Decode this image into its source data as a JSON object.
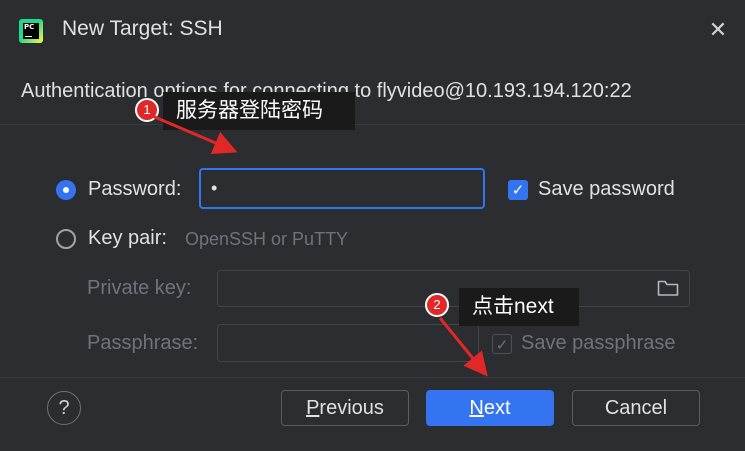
{
  "window": {
    "title": "New Target: SSH",
    "close_glyph": "✕",
    "app_icon_text": "PC"
  },
  "header": {
    "text": "Authentication options for connecting to flyvideo@10.193.194.120:22"
  },
  "auth": {
    "password_label": "Password:",
    "password_value": "•",
    "save_password_label": "Save password",
    "save_password_checked": true,
    "keypair_label": "Key pair:",
    "keypair_hint": "OpenSSH or PuTTY",
    "private_key_label": "Private key:",
    "private_key_value": "",
    "passphrase_label": "Passphrase:",
    "passphrase_value": "",
    "save_passphrase_label": "Save passphrase",
    "save_passphrase_checked": true,
    "selected": "password"
  },
  "footer": {
    "help_glyph": "?",
    "previous_first": "P",
    "previous_rest": "revious",
    "next_first": "N",
    "next_rest": "ext",
    "cancel_label": "Cancel"
  },
  "annotations": [
    {
      "number": "1",
      "text": "服务器登陆密码"
    },
    {
      "number": "2",
      "text": "点击next"
    }
  ],
  "colors": {
    "accent": "#3574f0",
    "background": "#2b2d30",
    "annotation_red": "#e02828",
    "annotation_bg": "#1a1a1a"
  }
}
